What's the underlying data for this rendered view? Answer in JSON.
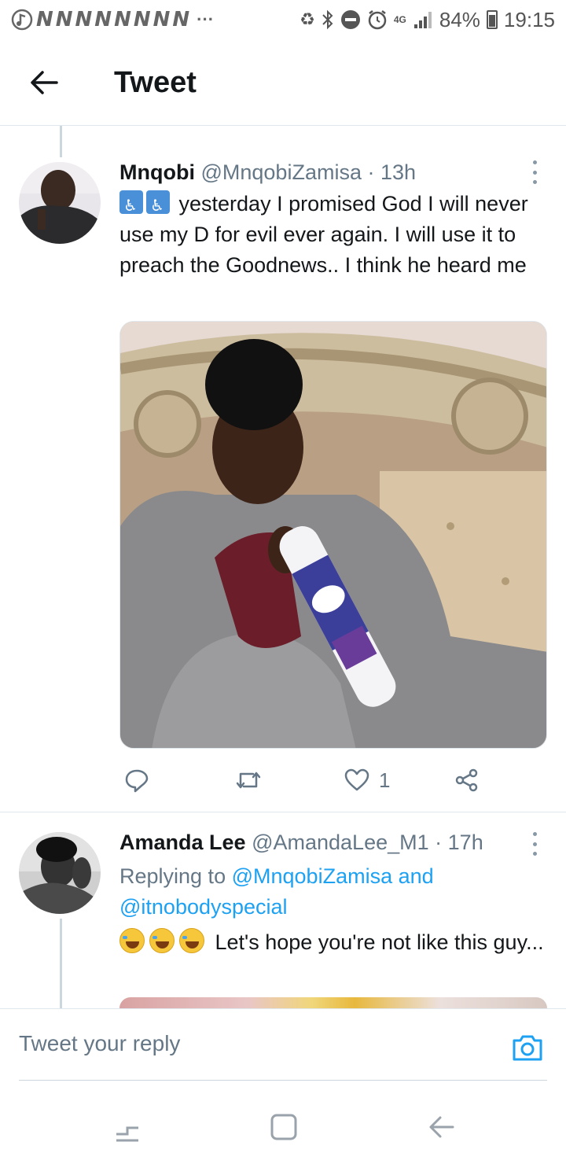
{
  "status_bar": {
    "notification_letters": [
      "N",
      "N",
      "N",
      "N",
      "N",
      "N",
      "N",
      "N"
    ],
    "more_dots": "···",
    "network": "4G",
    "battery": "84%",
    "time": "19:15"
  },
  "header": {
    "title": "Tweet"
  },
  "tweets": [
    {
      "name": "Mnqobi",
      "handle": "@MnqobiZamisa",
      "separator": "·",
      "time": "13h",
      "text": "yesterday I promised God I will never use my D for evil ever again. I will use it to preach the Goodnews.. I think he heard me",
      "text_emojis": [
        "wheelchair-symbol",
        "wheelchair-symbol"
      ],
      "media_description_icon": "photo",
      "actions": {
        "reply_count": "",
        "retweet_count": "",
        "like_count": "1",
        "share_count": ""
      }
    },
    {
      "name": "Amanda Lee",
      "handle": "@AmandaLee_M1",
      "separator": "·",
      "time": "17h",
      "replying_prefix": "Replying to",
      "replying_to_1": "@MnqobiZamisa",
      "replying_joiner": "and",
      "replying_to_2": "@itnobodyspecial",
      "text": "Let's hope you're not like this guy...",
      "text_emojis": [
        "face-with-tears-of-joy",
        "face-with-tears-of-joy",
        "face-with-tears-of-joy"
      ]
    }
  ],
  "reply_box": {
    "placeholder": "Tweet your reply"
  },
  "colors": {
    "accent": "#1da1f2",
    "secondary_text": "#657786",
    "divider": "#e1e8ed"
  },
  "icons": {
    "back": "arrow-left-icon",
    "more": "more-vertical-icon",
    "reply": "reply-icon",
    "retweet": "retweet-icon",
    "like": "heart-icon",
    "share": "share-icon",
    "camera": "camera-icon",
    "nav_recent": "recent-apps-icon",
    "nav_home": "home-icon",
    "nav_back": "nav-back-icon"
  }
}
